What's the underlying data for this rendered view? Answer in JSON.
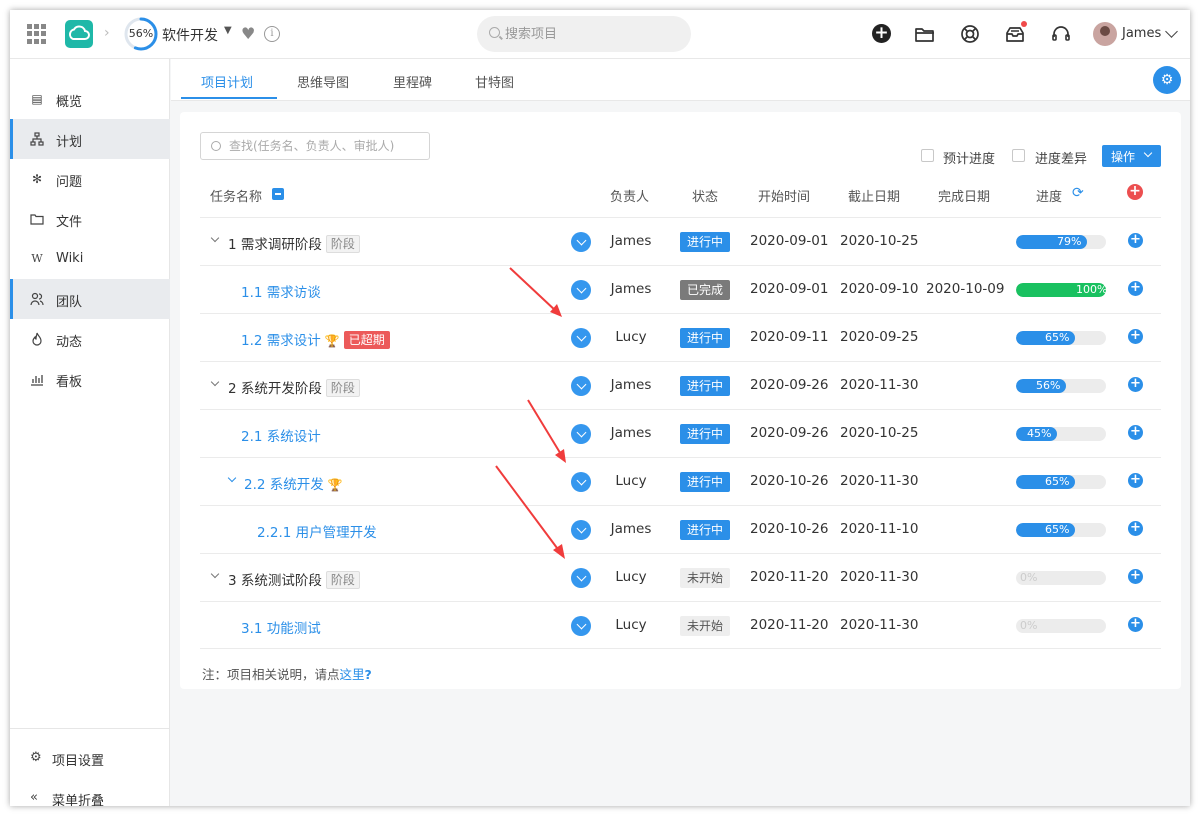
{
  "header": {
    "progress_text": "56%",
    "progress_value": 0.56,
    "project_name": "软件开发",
    "search_placeholder": "搜索项目",
    "user_name": "James"
  },
  "sidebar": {
    "items": [
      {
        "label": "概览",
        "icon": "document-icon"
      },
      {
        "label": "计划",
        "icon": "hierarchy-icon"
      },
      {
        "label": "问题",
        "icon": "bug-icon"
      },
      {
        "label": "文件",
        "icon": "folder-icon"
      },
      {
        "label": "Wiki",
        "icon": "wiki-icon"
      },
      {
        "label": "团队",
        "icon": "team-icon"
      },
      {
        "label": "动态",
        "icon": "flame-icon"
      },
      {
        "label": "看板",
        "icon": "chart-icon"
      }
    ],
    "settings_label": "项目设置",
    "collapse_label": "菜单折叠"
  },
  "tabs": [
    {
      "label": "项目计划"
    },
    {
      "label": "思维导图"
    },
    {
      "label": "里程碑"
    },
    {
      "label": "甘特图"
    }
  ],
  "toolbar": {
    "filter_placeholder": "查找(任务名、负责人、审批人)",
    "estimate_label": "预计进度",
    "diff_label": "进度差异",
    "action_label": "操作"
  },
  "table": {
    "headers": {
      "task": "任务名称",
      "owner": "负责人",
      "status": "状态",
      "start": "开始时间",
      "due": "截止日期",
      "done": "完成日期",
      "progress": "进度"
    },
    "phase_tag": "阶段",
    "overdue_tag": "已超期",
    "rows": [
      {
        "name": "1 需求调研阶段",
        "owner": "James",
        "status": "进行中",
        "start": "2020-09-01",
        "due": "2020-10-25",
        "done": "",
        "progress_text": "79%",
        "progress": 79
      },
      {
        "name": "1.1 需求访谈",
        "owner": "James",
        "status": "已完成",
        "start": "2020-09-01",
        "due": "2020-09-10",
        "done": "2020-10-09",
        "progress_text": "100%",
        "progress": 100
      },
      {
        "name": "1.2 需求设计",
        "owner": "Lucy",
        "status": "进行中",
        "start": "2020-09-11",
        "due": "2020-09-25",
        "done": "",
        "progress_text": "65%",
        "progress": 65
      },
      {
        "name": "2 系统开发阶段",
        "owner": "James",
        "status": "进行中",
        "start": "2020-09-26",
        "due": "2020-11-30",
        "done": "",
        "progress_text": "56%",
        "progress": 56
      },
      {
        "name": "2.1 系统设计",
        "owner": "James",
        "status": "进行中",
        "start": "2020-09-26",
        "due": "2020-10-25",
        "done": "",
        "progress_text": "45%",
        "progress": 45
      },
      {
        "name": "2.2 系统开发",
        "owner": "Lucy",
        "status": "进行中",
        "start": "2020-10-26",
        "due": "2020-11-30",
        "done": "",
        "progress_text": "65%",
        "progress": 65
      },
      {
        "name": "2.2.1 用户管理开发",
        "owner": "James",
        "status": "进行中",
        "start": "2020-10-26",
        "due": "2020-11-10",
        "done": "",
        "progress_text": "65%",
        "progress": 65
      },
      {
        "name": "3 系统测试阶段",
        "owner": "Lucy",
        "status": "未开始",
        "start": "2020-11-20",
        "due": "2020-11-30",
        "done": "",
        "progress_text": "0%",
        "progress": 0
      },
      {
        "name": "3.1 功能测试",
        "owner": "Lucy",
        "status": "未开始",
        "start": "2020-11-20",
        "due": "2020-11-30",
        "done": "",
        "progress_text": "0%",
        "progress": 0
      }
    ]
  },
  "note": {
    "prefix": "注：项目相关说明，请点",
    "link": "这里",
    "suffix": "?"
  },
  "colors": {
    "accent": "#2b8fe8",
    "success": "#19c160",
    "danger": "#ec5a5a",
    "annotation_arrow": "#f03c3c"
  }
}
